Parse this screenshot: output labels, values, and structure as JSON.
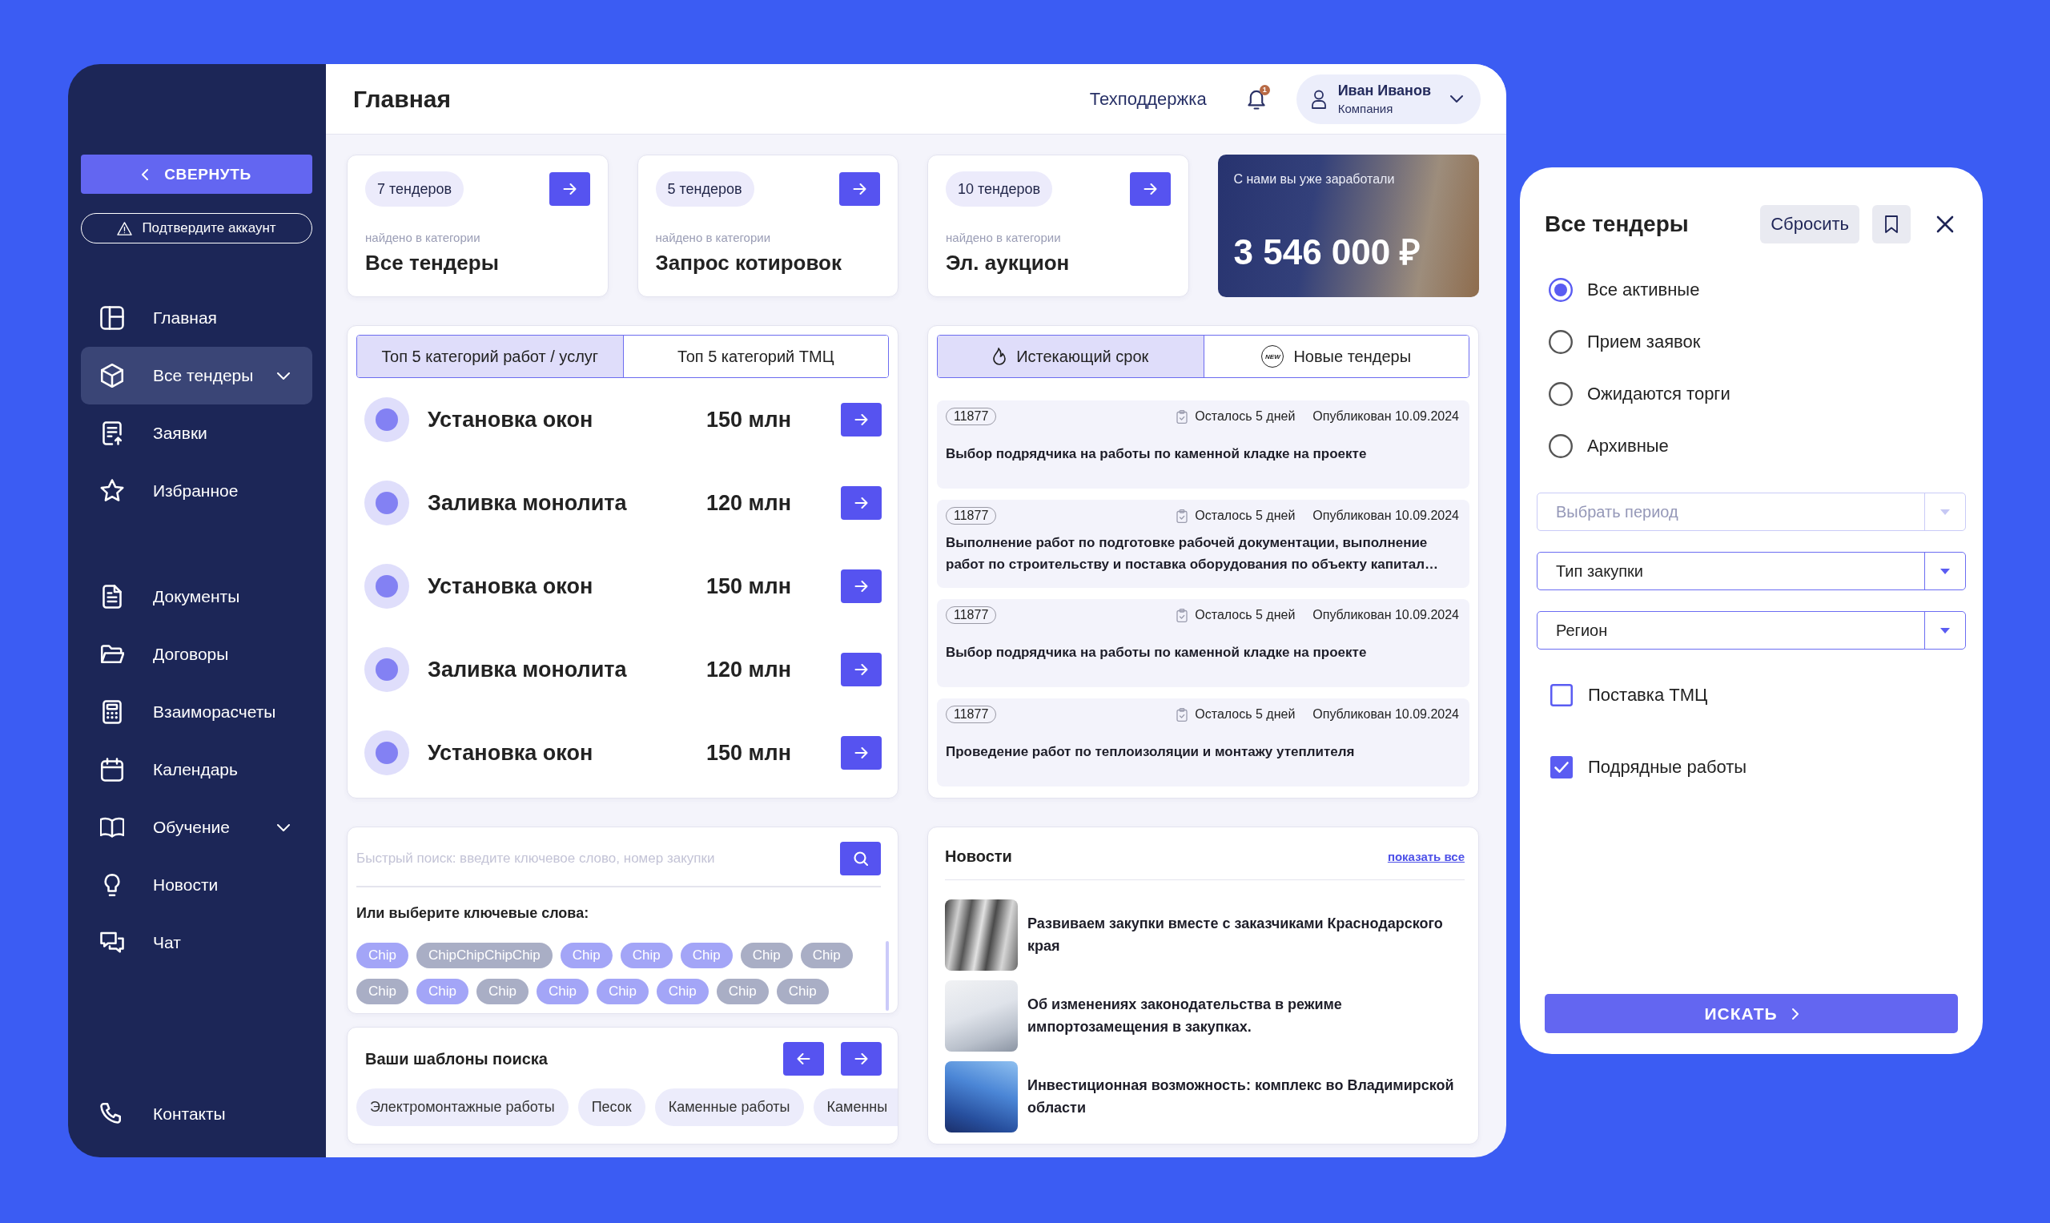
{
  "sidebar": {
    "collapse_button": "СВЕРНУТЬ",
    "verify_button": "Подтвердите аккаунт",
    "nav_main": [
      {
        "label": "Главная",
        "kind": "link",
        "selected": false
      },
      {
        "label": "Все тендеры",
        "kind": "group",
        "selected": true
      },
      {
        "label": "Заявки",
        "kind": "link",
        "selected": false
      },
      {
        "label": "Избранное",
        "kind": "link",
        "selected": false
      }
    ],
    "nav_more": [
      {
        "label": "Документы",
        "kind": "link",
        "selected": false
      },
      {
        "label": "Договоры",
        "kind": "link",
        "selected": false
      },
      {
        "label": "Взаиморасчеты",
        "kind": "link",
        "selected": false
      },
      {
        "label": "Календарь",
        "kind": "link",
        "selected": false
      },
      {
        "label": "Обучение",
        "kind": "group",
        "selected": false
      },
      {
        "label": "Новости",
        "kind": "link",
        "selected": false
      },
      {
        "label": "Чат",
        "kind": "link",
        "selected": false
      }
    ],
    "contacts": "Контакты"
  },
  "header": {
    "title": "Главная",
    "support_link": "Техподдержка",
    "notification_count": "1",
    "user": {
      "name": "Иван Иванов",
      "company": "Компания"
    }
  },
  "category_cards": [
    {
      "count": "7 тендеров",
      "caption": "найдено в категории",
      "title": "Все тендеры"
    },
    {
      "count": "5 тендеров",
      "caption": "найдено в категории",
      "title": "Запрос котировок"
    },
    {
      "count": "10 тендеров",
      "caption": "найдено в категории",
      "title": "Эл. аукцион"
    }
  ],
  "earnings_card": {
    "caption": "С нами вы уже заработали",
    "amount": "3 546 000 ₽"
  },
  "top_categories": {
    "tabs": [
      {
        "label": "Топ 5 категорий работ / услуг",
        "selected": true
      },
      {
        "label": "Топ 5 категорий ТМЦ",
        "selected": false
      }
    ],
    "rows": [
      {
        "name": "Установка окон",
        "value": "150 млн"
      },
      {
        "name": "Заливка монолита",
        "value": "120 млн"
      },
      {
        "name": "Установка окон",
        "value": "150 млн"
      },
      {
        "name": "Заливка монолита",
        "value": "120 млн"
      },
      {
        "name": "Установка окон",
        "value": "150 млн"
      }
    ]
  },
  "tenders": {
    "tabs": [
      {
        "label": "Истекающий срок",
        "selected": true,
        "kind": "flame"
      },
      {
        "label": "Новые тендеры",
        "selected": false,
        "kind": "badge",
        "badge": "NEW"
      }
    ],
    "items": [
      {
        "number": "11877",
        "remaining": "Осталось 5 дней",
        "published": "Опубликован 10.09.2024",
        "title": "Выбор подрядчика на работы по каменной кладке на проекте"
      },
      {
        "number": "11877",
        "remaining": "Осталось 5 дней",
        "published": "Опубликован 10.09.2024",
        "title": "Выполнение работ по подготовке рабочей документации, выполнение работ по строительству и поставка оборудования по объекту капитал…"
      },
      {
        "number": "11877",
        "remaining": "Осталось 5 дней",
        "published": "Опубликован 10.09.2024",
        "title": "Выбор подрядчика на работы по каменной кладке на проекте"
      },
      {
        "number": "11877",
        "remaining": "Осталось 5 дней",
        "published": "Опубликован 10.09.2024",
        "title": "Проведение работ по теплоизоляции и монтажу утеплителя"
      }
    ]
  },
  "quick_search": {
    "placeholder": "Быстрый поиск: введите ключевое слово, номер закупки",
    "keywords_label": "Или выберите ключевые слова:",
    "chips": [
      {
        "label": "Chip",
        "selected": true
      },
      {
        "label": "ChipChipChipChip",
        "selected": false
      },
      {
        "label": "Chip",
        "selected": true
      },
      {
        "label": "Chip",
        "selected": true
      },
      {
        "label": "Chip",
        "selected": true
      },
      {
        "label": "Chip",
        "selected": false
      },
      {
        "label": "Chip",
        "selected": false
      },
      {
        "label": "Chip",
        "selected": false
      },
      {
        "label": "Chip",
        "selected": true
      },
      {
        "label": "Chip",
        "selected": false
      },
      {
        "label": "Chip",
        "selected": true
      },
      {
        "label": "Chip",
        "selected": true
      },
      {
        "label": "Chip",
        "selected": true
      },
      {
        "label": "Chip",
        "selected": false
      },
      {
        "label": "Chip",
        "selected": false
      }
    ]
  },
  "search_templates": {
    "title": "Ваши шаблоны поиска",
    "templates": [
      "Электромонтажные работы",
      "Песок",
      "Каменные работы",
      "Каменны"
    ]
  },
  "news": {
    "title": "Новости",
    "show_all": "показать все",
    "items": [
      {
        "title": "Развиваем закупки вместе с заказчиками Краснодарского края"
      },
      {
        "title": "Об изменениях законодательства в режиме импортозамещения в закупках."
      },
      {
        "title": "Инвестиционная возможность: комплекс во Владимирской области"
      }
    ]
  },
  "filter_panel": {
    "title": "Все тендеры",
    "reset_button": "Сбросить",
    "statuses": [
      {
        "label": "Все активные",
        "selected": true
      },
      {
        "label": "Прием заявок",
        "selected": false
      },
      {
        "label": "Ожидаются торги",
        "selected": false
      },
      {
        "label": "Архивные",
        "selected": false
      }
    ],
    "selects": [
      {
        "text": "Выбрать период",
        "disabled": true
      },
      {
        "text": "Тип закупки",
        "disabled": false
      },
      {
        "text": "Регион",
        "disabled": false
      }
    ],
    "checkboxes": [
      {
        "label": "Поставка ТМЦ",
        "checked": false
      },
      {
        "label": "Подрядные работы",
        "checked": true
      }
    ],
    "search_button": "ИСКАТЬ"
  }
}
